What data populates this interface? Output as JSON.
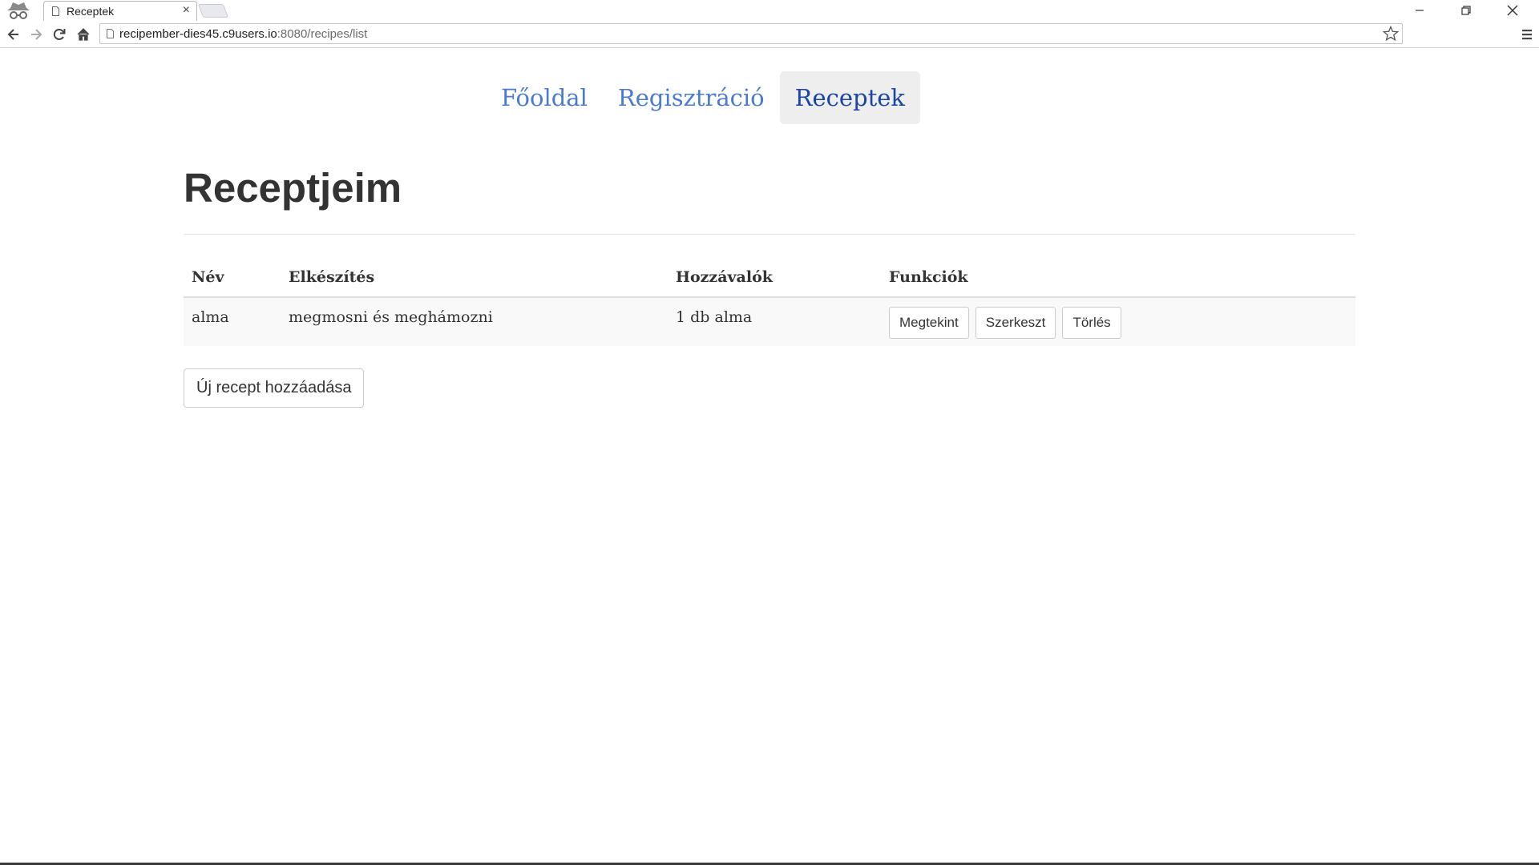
{
  "browser": {
    "tab_title": "Receptek",
    "tab_close": "×",
    "url_host": "recipember-dies45.c9users.io",
    "url_rest": ":8080/recipes/list"
  },
  "nav": {
    "items": [
      {
        "label": "Főoldal"
      },
      {
        "label": "Regisztráció"
      },
      {
        "label": "Receptek",
        "active": true
      }
    ]
  },
  "main": {
    "title": "Receptjeim",
    "table": {
      "headers": [
        "Név",
        "Elkészítés",
        "Hozzávalók",
        "Funkciók"
      ],
      "rows": [
        {
          "name": "alma",
          "preparation": "megmosni és meghámozni",
          "ingredients": "1 db alma",
          "actions": [
            "Megtekint",
            "Szerkeszt",
            "Törlés"
          ]
        }
      ]
    },
    "add_button": "Új recept hozzáadása"
  },
  "colors": {
    "nav_link": "#4a7bd4",
    "nav_active": "#1a44a8",
    "nav_active_bg": "#eeeeee",
    "text": "#333333"
  }
}
